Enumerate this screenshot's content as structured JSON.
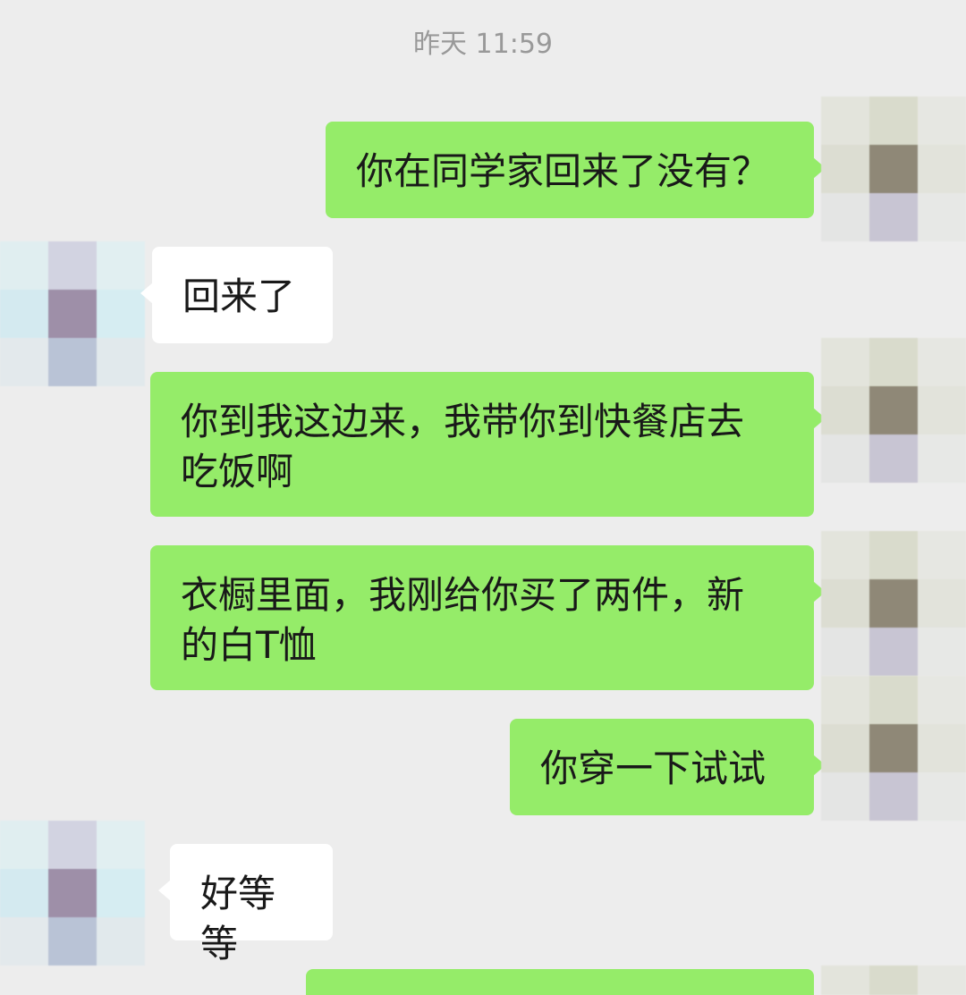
{
  "chat": {
    "timestamp": "昨天 11:59",
    "messages": [
      {
        "sender": "me",
        "text": "你在同学家回来了没有？"
      },
      {
        "sender": "friend",
        "text": "回来了"
      },
      {
        "sender": "me",
        "text": "你到我这边来，我带你到快餐店去\n吃饭啊"
      },
      {
        "sender": "me",
        "text": "衣橱里面，我刚给你买了两件，新\n的白T恤"
      },
      {
        "sender": "me",
        "text": "你穿一下试试"
      },
      {
        "sender": "friend",
        "text": "好等等"
      },
      {
        "sender": "me",
        "text": ""
      }
    ]
  },
  "colors": {
    "background": "#EDEDED",
    "outgoing_bubble": "#95EC69",
    "incoming_bubble": "#FFFFFF",
    "timestamp_text": "#999999",
    "message_text": "#191919"
  },
  "icons": {
    "me_avatar": "pixelated-avatar-icon",
    "friend_avatar": "pixelated-avatar-icon"
  }
}
